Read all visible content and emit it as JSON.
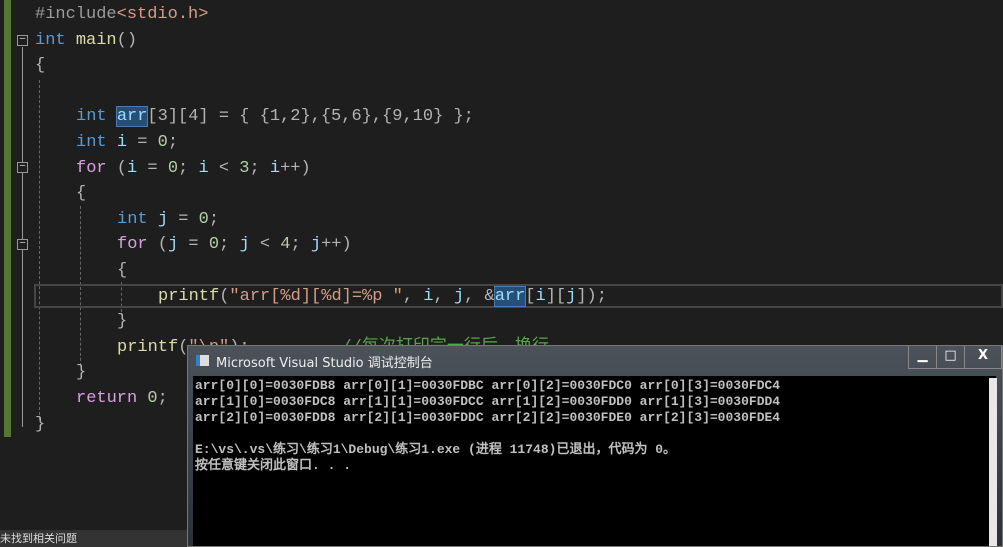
{
  "editor": {
    "lines": [
      [
        [
          "#include",
          "pp"
        ],
        [
          "<stdio.h>",
          "inc"
        ]
      ],
      [
        [
          "int",
          "kw"
        ],
        [
          " ",
          ""
        ],
        [
          "main",
          "fn"
        ],
        [
          "()",
          "punc"
        ]
      ],
      [
        [
          "{",
          "punc"
        ]
      ],
      [],
      [
        [
          "int",
          "kw"
        ],
        [
          " ",
          ""
        ],
        [
          "arr",
          "id hl"
        ],
        [
          "[3][4] = { {1,2},{5,6},{9,10} };",
          "punc"
        ]
      ],
      [
        [
          "int",
          "kw"
        ],
        [
          " ",
          ""
        ],
        [
          "i",
          "id"
        ],
        [
          " = ",
          "punc"
        ],
        [
          "0",
          "num"
        ],
        [
          ";",
          "punc"
        ]
      ],
      [
        [
          "for",
          "ctl"
        ],
        [
          " (",
          "punc"
        ],
        [
          "i",
          "id"
        ],
        [
          " = ",
          "punc"
        ],
        [
          "0",
          "num"
        ],
        [
          "; ",
          "punc"
        ],
        [
          "i",
          "id"
        ],
        [
          " < ",
          "punc"
        ],
        [
          "3",
          "num"
        ],
        [
          "; ",
          "punc"
        ],
        [
          "i",
          "id"
        ],
        [
          "++)",
          "punc"
        ]
      ],
      [
        [
          "{",
          "punc"
        ]
      ],
      [
        [
          "int",
          "kw"
        ],
        [
          " ",
          ""
        ],
        [
          "j",
          "id"
        ],
        [
          " = ",
          "punc"
        ],
        [
          "0",
          "num"
        ],
        [
          ";",
          "punc"
        ]
      ],
      [
        [
          "for",
          "ctl"
        ],
        [
          " (",
          "punc"
        ],
        [
          "j",
          "id"
        ],
        [
          " = ",
          "punc"
        ],
        [
          "0",
          "num"
        ],
        [
          "; ",
          "punc"
        ],
        [
          "j",
          "id"
        ],
        [
          " < ",
          "punc"
        ],
        [
          "4",
          "num"
        ],
        [
          "; ",
          "punc"
        ],
        [
          "j",
          "id"
        ],
        [
          "++)",
          "punc"
        ]
      ],
      [
        [
          "{",
          "punc"
        ]
      ],
      [
        [
          "printf",
          "fn"
        ],
        [
          "(",
          "punc"
        ],
        [
          "\"arr[%d][%d]=%p \"",
          "str"
        ],
        [
          ", ",
          "punc"
        ],
        [
          "i",
          "id"
        ],
        [
          ", ",
          "punc"
        ],
        [
          "j",
          "id"
        ],
        [
          ", &",
          "punc"
        ],
        [
          "arr",
          "id hl"
        ],
        [
          "[",
          "punc"
        ],
        [
          "i",
          "id"
        ],
        [
          "][",
          "punc"
        ],
        [
          "j",
          "id"
        ],
        [
          "]);",
          "punc"
        ]
      ],
      [
        [
          "}",
          "punc"
        ]
      ],
      [
        [
          "printf",
          "fn"
        ],
        [
          "(",
          "punc"
        ],
        [
          "\"\\n\"",
          "str"
        ],
        [
          ");",
          "punc"
        ],
        [
          "         //每次打印完一行后，换行",
          "cmt"
        ]
      ],
      [
        [
          "}",
          "punc"
        ]
      ],
      [
        [
          "return",
          "ctl"
        ],
        [
          " ",
          ""
        ],
        [
          "0",
          "num"
        ],
        [
          ";",
          "punc"
        ]
      ],
      [
        [
          "}",
          "punc"
        ]
      ]
    ],
    "indents": [
      0,
      0,
      0,
      0,
      1,
      1,
      1,
      1,
      2,
      2,
      2,
      3,
      2,
      2,
      1,
      1,
      0
    ]
  },
  "console": {
    "title": "Microsoft Visual Studio 调试控制台",
    "buttons": {
      "minimize": "▁",
      "maximize": "□",
      "close": "X"
    },
    "lines": [
      "arr[0][0]=0030FDB8 arr[0][1]=0030FDBC arr[0][2]=0030FDC0 arr[0][3]=0030FDC4",
      "arr[1][0]=0030FDC8 arr[1][1]=0030FDCC arr[1][2]=0030FDD0 arr[1][3]=0030FDD4",
      "arr[2][0]=0030FDD8 arr[2][1]=0030FDDC arr[2][2]=0030FDE0 arr[2][3]=0030FDE4",
      "",
      "E:\\vs\\.vs\\练习\\练习1\\Debug\\练习1.exe (进程 11748)已退出，代码为 0。",
      "按任意键关闭此窗口. . ."
    ]
  },
  "status": {
    "text": "未找到相关问题"
  }
}
